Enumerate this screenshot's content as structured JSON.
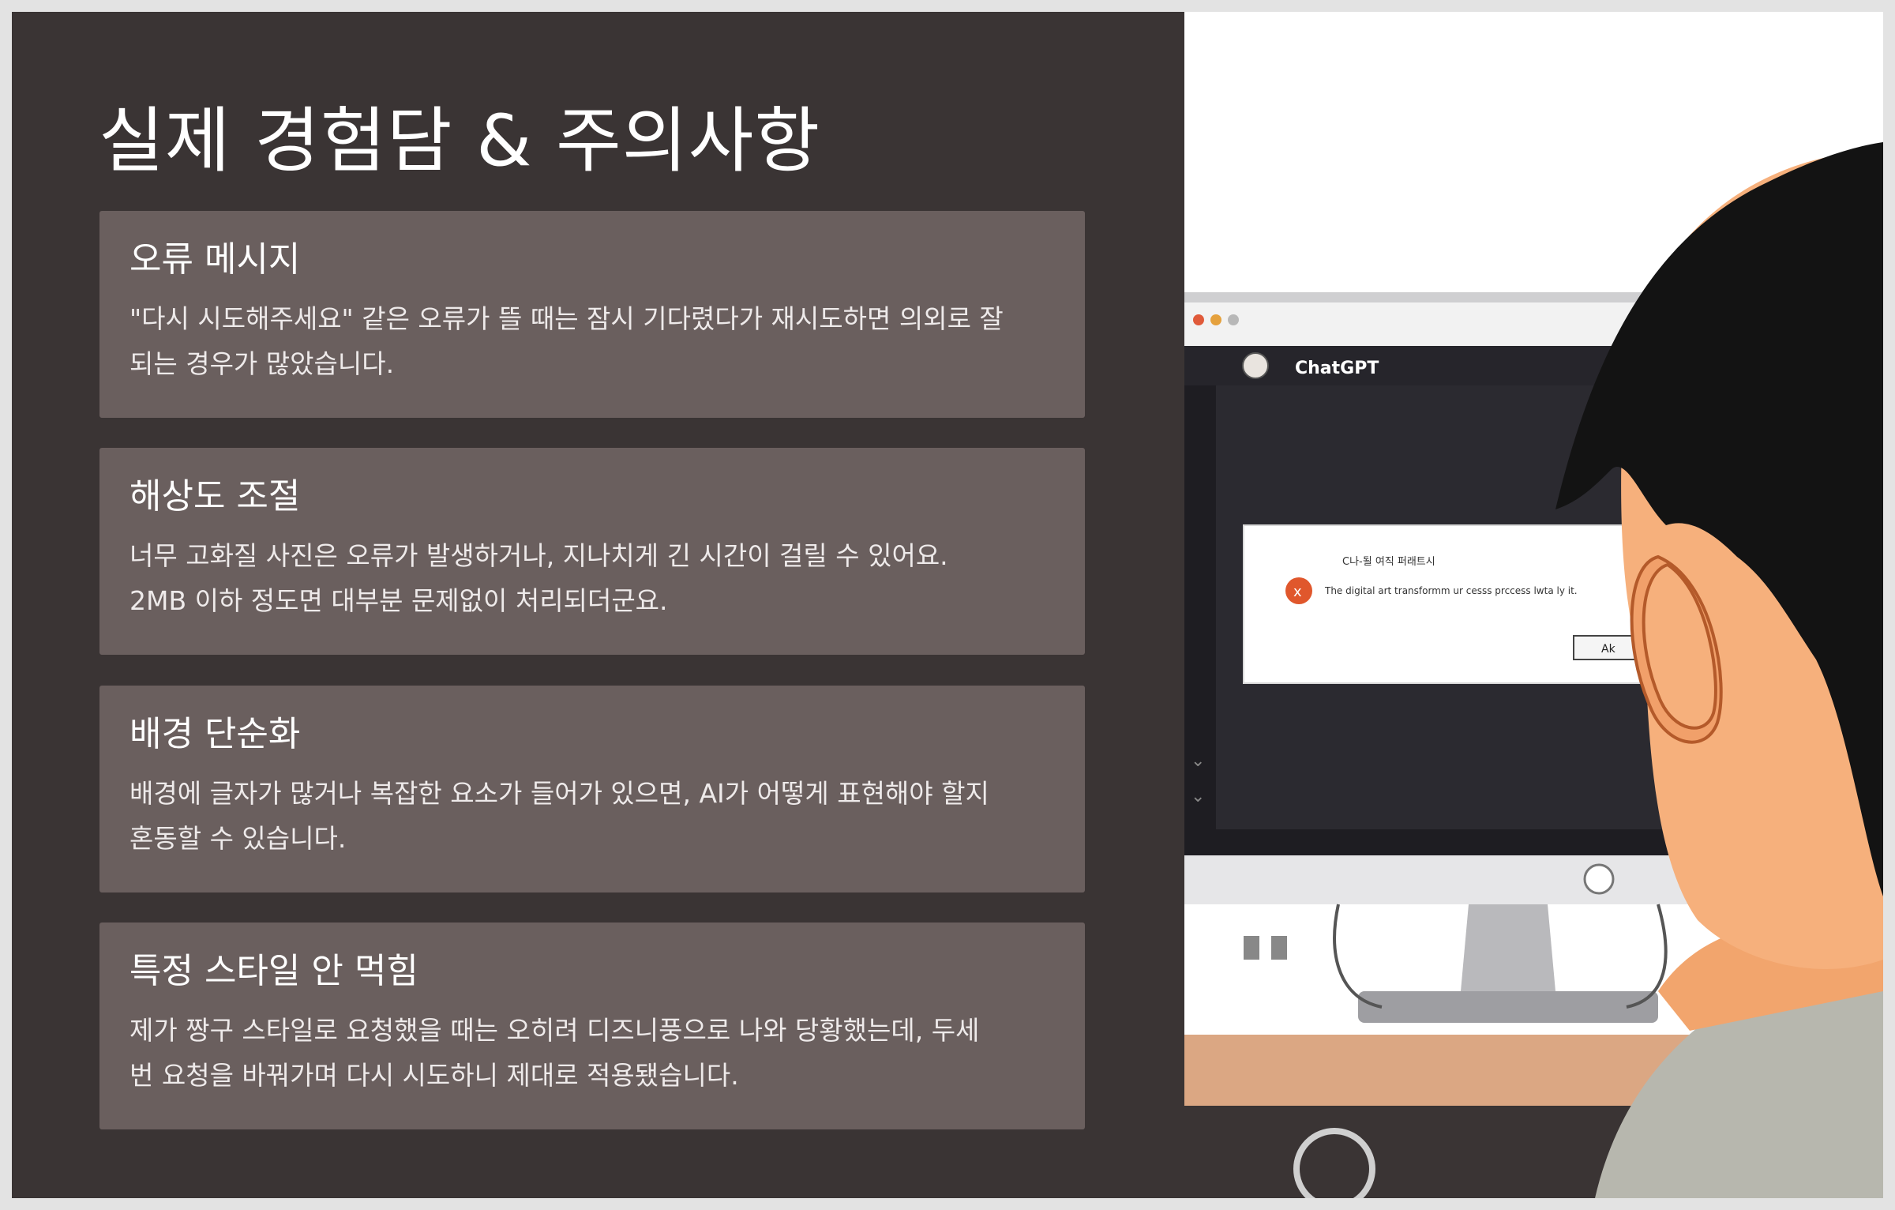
{
  "slide": {
    "title": "실제 경험담 & 주의사항",
    "cards": [
      {
        "title": "오류 메시지",
        "lines": [
          "\"다시 시도해주세요\" 같은 오류가 뜰 때는 잠시 기다렸다가 재시도하면 의외로 잘",
          "되는 경우가 많았습니다."
        ]
      },
      {
        "title": "해상도 조절",
        "lines": [
          "너무 고화질 사진은 오류가 발생하거나, 지나치게 긴 시간이 걸릴 수 있어요.",
          "2MB 이하 정도면 대부분 문제없이 처리되더군요."
        ]
      },
      {
        "title": "배경 단순화",
        "lines": [
          "배경에 글자가 많거나 복잡한 요소가 들어가 있으면, AI가 어떻게 표현해야 할지",
          "혼동할 수 있습니다."
        ]
      },
      {
        "title": "특정 스타일 안 먹힘",
        "lines": [
          "제가 짱구 스타일로 요청했을 때는 오히려 디즈니풍으로 나와 당황했는데, 두세",
          "번 요청을 바꿔가며 다시 시도하니 제대로 적용됐습니다."
        ]
      }
    ]
  },
  "illustration": {
    "app_name": "ChatGPT",
    "dialog_title": "C나-될 여직 퍼래트시",
    "dialog_message": "The digital art transformm ur cesss prccess lwta ly it.",
    "dialog_button": "Ak",
    "error_icon": "x-circle-icon",
    "colors": {
      "left_panel": "#3a3434",
      "card": "#6a5f5e",
      "error_red": "#e0572c",
      "monitor_screen": "#2b2a30"
    }
  }
}
